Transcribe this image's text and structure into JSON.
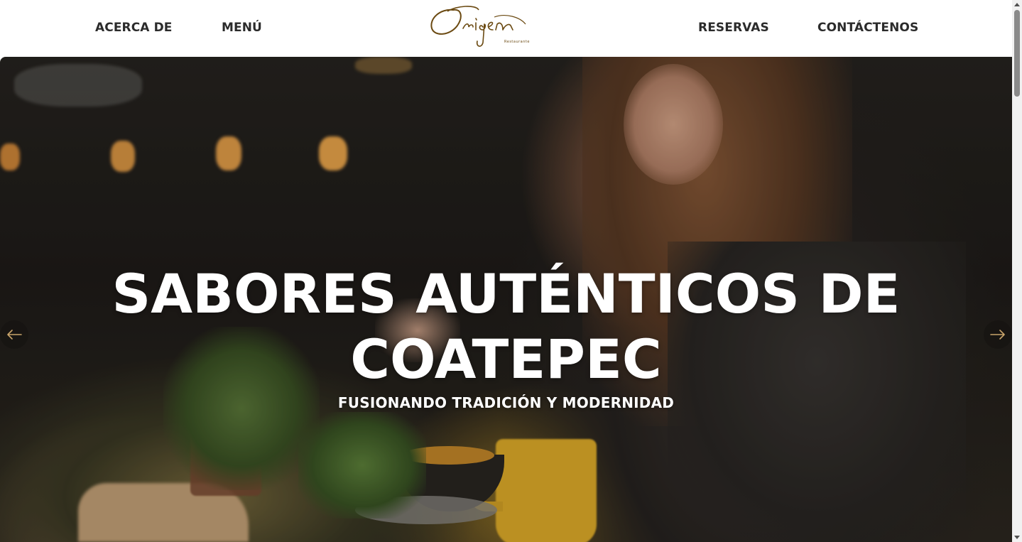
{
  "nav": {
    "left": [
      "ACERCA DE",
      "MENÚ"
    ],
    "right": [
      "RESERVAS",
      "CONTÁCTENOS"
    ]
  },
  "logo": {
    "name": "Origen",
    "tagline": "Restaurante",
    "color": "#6b4a12"
  },
  "hero": {
    "title_line1": "SABORES AUTÉNTICOS DE",
    "title_line2": "COATEPEC",
    "subtitle": "FUSIONANDO TRADICIÓN Y MODERNIDAD",
    "prev_icon": "arrow-left-icon",
    "next_icon": "arrow-right-icon"
  }
}
